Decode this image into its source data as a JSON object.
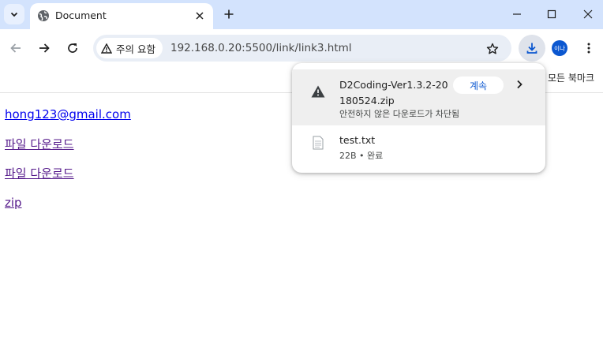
{
  "tab": {
    "title": "Document",
    "favicon": "globe-icon"
  },
  "toolbar": {
    "security_chip": "주의 요함",
    "url": "192.168.0.20:5500/link/link3.html",
    "avatar_text": "이나"
  },
  "bookmarks_bar": {
    "all_bookmarks": "모든 북마크"
  },
  "page": {
    "links": [
      {
        "text": "hong123@gmail.com"
      },
      {
        "text": "파일 다운로드"
      },
      {
        "text": "파일 다운로드"
      },
      {
        "text": "zip"
      }
    ]
  },
  "downloads": {
    "items": [
      {
        "filename": "D2Coding-Ver1.3.2-20180524.zip",
        "status": "안전하지 않은 다운로드가 차단됨",
        "action": "계속",
        "icon": "warning-icon"
      },
      {
        "filename": "test.txt",
        "size": "22B",
        "status_sep": "•",
        "status": "완료",
        "icon": "file-icon"
      }
    ]
  },
  "colors": {
    "tab_strip": "#d3e3fd",
    "accent": "#0b57d0",
    "link_visited": "#551a8b",
    "link": "#0000ee"
  }
}
